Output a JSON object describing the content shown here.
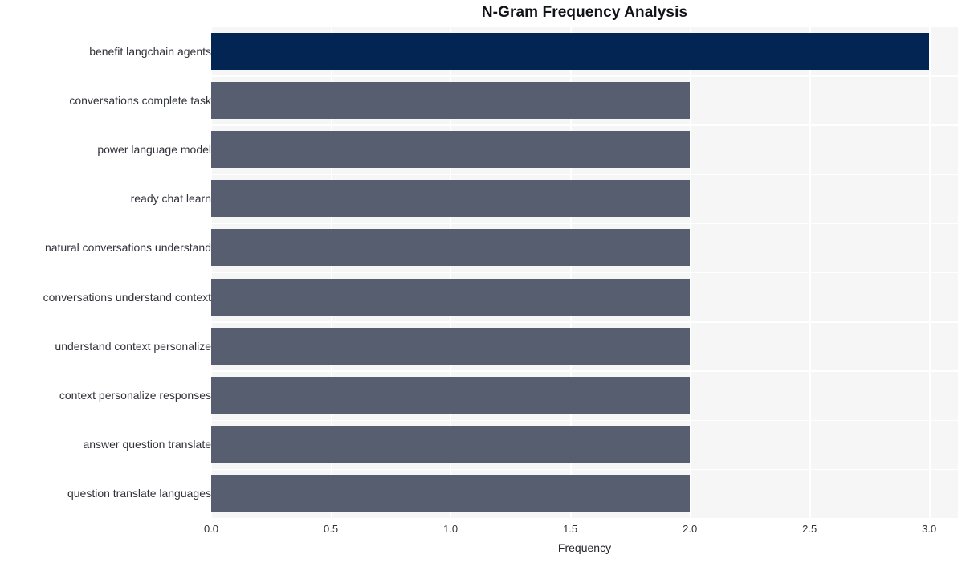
{
  "chart_data": {
    "type": "bar",
    "orientation": "horizontal",
    "title": "N-Gram Frequency Analysis",
    "xlabel": "Frequency",
    "ylabel": "",
    "categories": [
      "benefit langchain agents",
      "conversations complete task",
      "power language model",
      "ready chat learn",
      "natural conversations understand",
      "conversations understand context",
      "understand context personalize",
      "context personalize responses",
      "answer question translate",
      "question translate languages"
    ],
    "values": [
      3,
      2,
      2,
      2,
      2,
      2,
      2,
      2,
      2,
      2
    ],
    "bar_colors": [
      "#032553",
      "#575e70",
      "#575e70",
      "#575e70",
      "#575e70",
      "#575e70",
      "#575e70",
      "#575e70",
      "#575e70",
      "#575e70"
    ],
    "xlim": [
      0,
      3.12
    ],
    "xticks": [
      0,
      0.5,
      1,
      1.5,
      2,
      2.5,
      3
    ],
    "xtick_labels": [
      "0.0",
      "0.5",
      "1.0",
      "1.5",
      "2.0",
      "2.5",
      "3.0"
    ],
    "grid": true,
    "grid_color": "#ffffff",
    "plot_background": "#f6f6f7",
    "figure_background": "#ffffff",
    "legend": null
  }
}
